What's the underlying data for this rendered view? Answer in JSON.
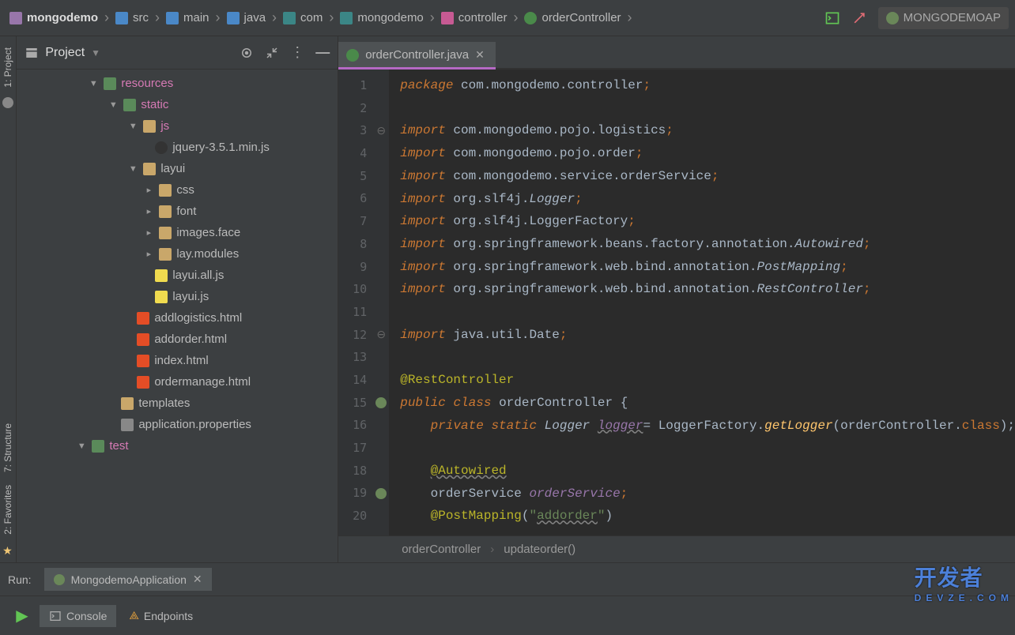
{
  "breadcrumb": {
    "items": [
      "mongodemo",
      "src",
      "main",
      "java",
      "com",
      "mongodemo",
      "controller",
      "orderController"
    ]
  },
  "run_config": "MONGODEMOAP",
  "project_panel": {
    "title": "Project",
    "tree": {
      "resources": "resources",
      "static": "static",
      "js": "js",
      "jquery": "jquery-3.5.1.min.js",
      "layui": "layui",
      "css": "css",
      "font": "font",
      "images_face": "images.face",
      "lay_modules": "lay.modules",
      "layui_all": "layui.all.js",
      "layui_js": "layui.js",
      "addlogistics": "addlogistics.html",
      "addorder": "addorder.html",
      "index": "index.html",
      "ordermanage": "ordermanage.html",
      "templates": "templates",
      "app_props": "application.properties",
      "test": "test"
    }
  },
  "editor": {
    "tab": "orderController.java",
    "crumb": {
      "a": "orderController",
      "b": "updateorder()"
    }
  },
  "code": {
    "l1_kw": "package",
    "l1_rest": " com.mongodemo.controller",
    "l3_kw": "import",
    "l3_rest": " com.mongodemo.pojo.logistics",
    "l4_kw": "import",
    "l4_rest": " com.mongodemo.pojo.order",
    "l5_kw": "import",
    "l5_rest": " com.mongodemo.service.orderService",
    "l6_kw": "import",
    "l6_a": " org.slf4j.",
    "l6_b": "Logger",
    "l7_kw": "import",
    "l7_rest": " org.slf4j.LoggerFactory",
    "l8_kw": "import",
    "l8_a": " org.springframework.beans.factory.annotation.",
    "l8_b": "Autowired",
    "l9_kw": "import",
    "l9_a": " org.springframework.web.bind.annotation.",
    "l9_b": "PostMapping",
    "l10_kw": "import",
    "l10_a": " org.springframework.web.bind.annotation.",
    "l10_b": "RestController",
    "l12_kw": "import",
    "l12_rest": " java.util.Date",
    "l14": "@RestController",
    "l15_a": "public",
    "l15_b": "class",
    "l15_c": "orderController {",
    "l16_a": "private",
    "l16_b": "static",
    "l16_c": "Logger",
    "l16_d": "logger",
    "l16_e": "= LoggerFactory.",
    "l16_f": "getLogger",
    "l16_g": "(orderController.",
    "l16_h": "class",
    "l16_i": ");",
    "l18": "@Autowired",
    "l19_a": "orderService",
    "l19_b": "orderService",
    "l20_a": "@PostMapping",
    "l20_b": "(",
    "l20_c": "\"",
    "l20_d": "addorder",
    "l20_e": "\"",
    "l20_f": ")"
  },
  "run": {
    "label": "Run:",
    "config": "MongodemoApplication",
    "console": "Console",
    "endpoints": "Endpoints"
  },
  "left_tabs": {
    "project": "1: Project",
    "structure": "7: Structure",
    "favorites": "2: Favorites"
  },
  "watermark": {
    "main": "开发者",
    "sub": "DEVZE.COM"
  }
}
